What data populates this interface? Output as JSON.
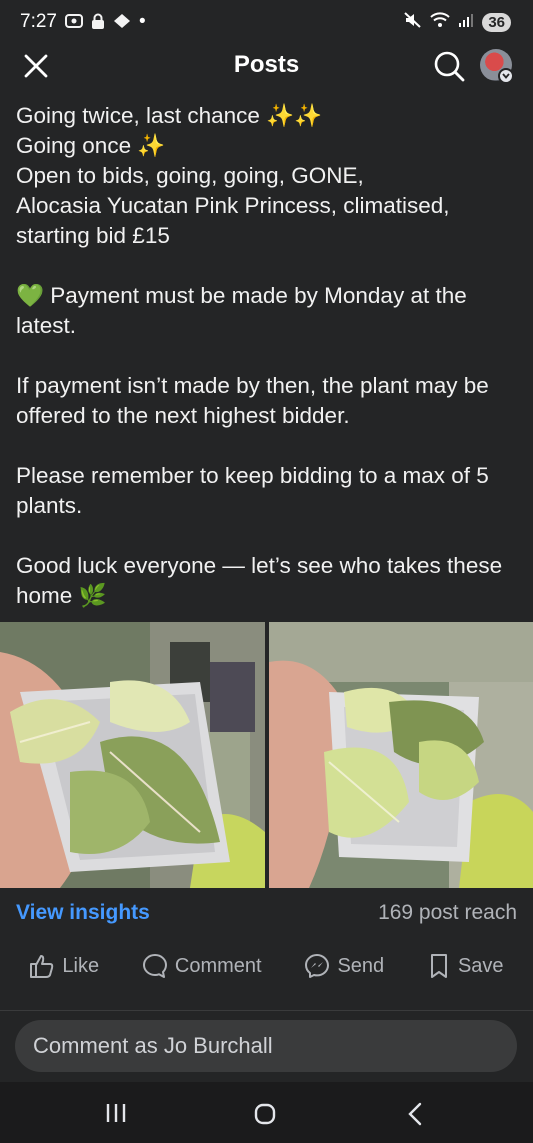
{
  "status_bar": {
    "time": "7:27",
    "dot": "•",
    "battery": "36",
    "icons": [
      "screenshot-icon",
      "lock-icon",
      "vpn-icon",
      "mute-icon",
      "wifi-icon",
      "signal-icon"
    ]
  },
  "header": {
    "title": "Posts"
  },
  "post": {
    "line1": "Going twice, last chance ✨✨",
    "line2": "Going once ✨",
    "line3": "Open to bids, going, going, GONE,",
    "line4": "Alocasia Yucatan Pink Princess, climatised,",
    "line5": "starting bid £15",
    "payment": "💚 Payment must be made by Monday at the latest.",
    "rule1": "If payment isn’t made by then, the plant may be offered to the next highest bidder.",
    "rule2": "Please remember to keep bidding to a max of 5 plants.",
    "closing": "Good luck everyone — let’s see who takes these home 🌿"
  },
  "insights": {
    "view_label": "View insights",
    "reach": "169 post reach"
  },
  "actions": {
    "like": "Like",
    "comment": "Comment",
    "send": "Send",
    "save": "Save"
  },
  "comment_box": {
    "placeholder": "Comment as Jo Burchall"
  },
  "colors": {
    "background": "#242526",
    "link": "#4599ff",
    "muted": "#b0b3b8"
  }
}
